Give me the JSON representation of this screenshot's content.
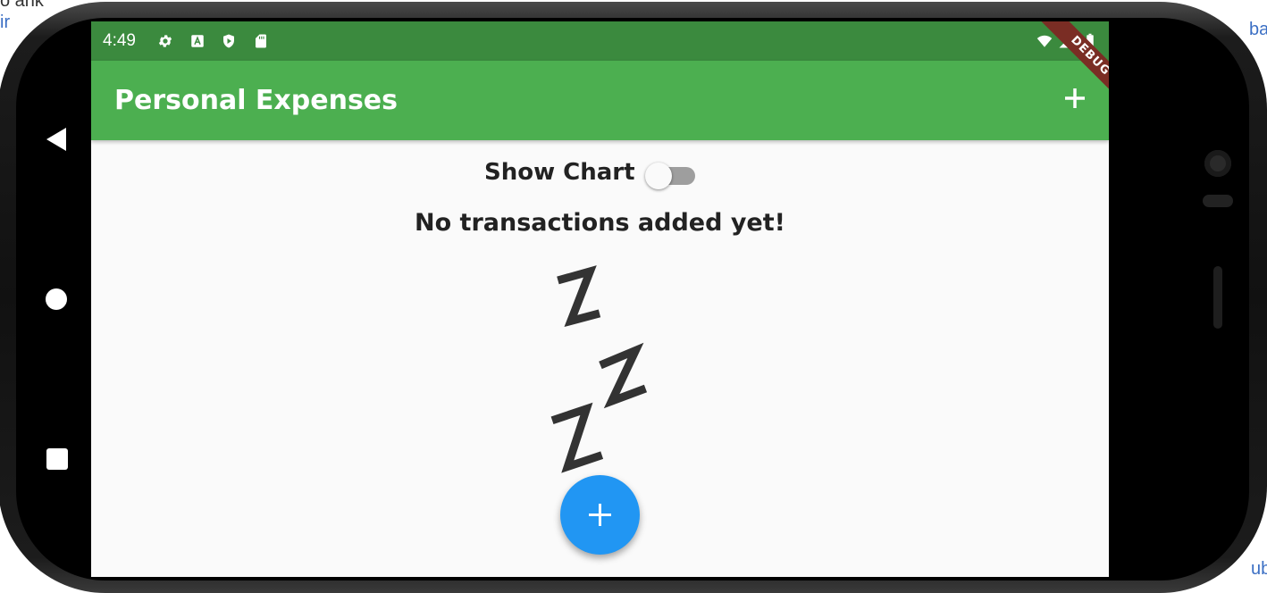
{
  "status_bar": {
    "time": "4:49",
    "icons": [
      "gear-icon",
      "keyboard-a-icon",
      "play-shield-icon",
      "sd-card-icon",
      "wifi-icon",
      "signal-icon",
      "battery-icon"
    ]
  },
  "app_bar": {
    "title": "Personal Expenses",
    "action_icon": "plus-icon",
    "debug_banner": "DEBUG",
    "background_color": "#4caf50",
    "status_color": "#3b8a3e"
  },
  "toggle": {
    "label": "Show Chart",
    "value": false
  },
  "empty_state": {
    "message": "No transactions added yet!",
    "image_icon": "sleeping-zzz-icon"
  },
  "fab": {
    "icon": "plus-icon",
    "color": "#2196f3"
  },
  "navigation": {
    "icons": [
      "back-icon",
      "home-icon",
      "recents-icon"
    ]
  }
}
